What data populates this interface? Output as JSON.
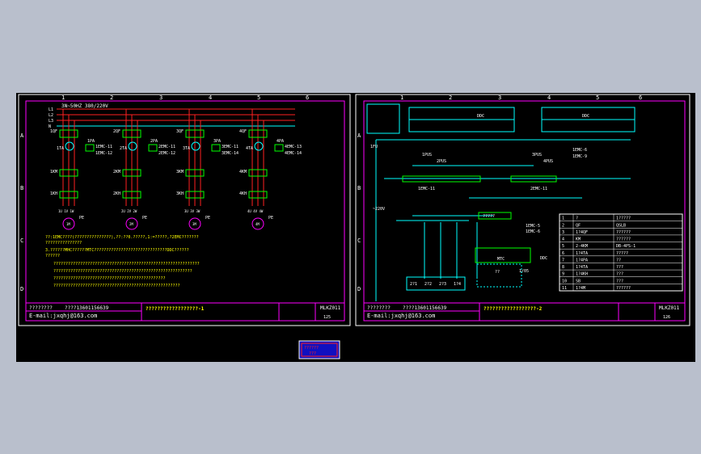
{
  "sheet1": {
    "supply": "3N~50HZ 380/220V",
    "bus_labels": [
      "L1",
      "L2",
      "L3",
      "N"
    ],
    "col_numbers": [
      "1",
      "2",
      "3",
      "4",
      "5",
      "6"
    ],
    "row_letters": [
      "A",
      "B",
      "C",
      "D"
    ],
    "pumps": [
      {
        "breaker": "1QF",
        "ct": "1TA",
        "pa": "1PA",
        "emc_a": "1EMC-11",
        "emc_b": "1EMC-12",
        "contactor": "1KM",
        "relay": "1KH",
        "terms": "1U 1V 1W",
        "motor": "1M",
        "pe": "PE"
      },
      {
        "breaker": "2QF",
        "ct": "2TA",
        "pa": "2PA",
        "emc_a": "2EMC-11",
        "emc_b": "2EMC-12",
        "contactor": "2KM",
        "relay": "2KH",
        "terms": "2U 2V 2W",
        "motor": "2M",
        "pe": "PE"
      },
      {
        "breaker": "3QF",
        "ct": "3TA",
        "pa": "3PA",
        "emc_a": "3EMC-11",
        "emc_b": "3EMC-14",
        "contactor": "3KM",
        "relay": "3KH",
        "terms": "3U 3V 3W",
        "motor": "3M",
        "pe": "PE"
      },
      {
        "breaker": "4QF",
        "ct": "4TA",
        "pa": "4PA",
        "emc_a": "4EMC-13",
        "emc_b": "4EMC-14",
        "contactor": "4KM",
        "relay": "4KH",
        "terms": "4U 4V 4W",
        "motor": "4M",
        "pe": "PE"
      }
    ],
    "notes": [
      "??:1EMC????(???????????????),??:??0.?????,1:=?????,?2EMC???????",
      "???????????????",
      "3.??????MHC??????MTC??????????????????????????????DDC??????",
      "??????",
      "????????????????????????????????????????????????????????????",
      "?????????????????????????????????????????????????????????",
      "??????????????????????????????????????????????",
      "????????????????????????????????????????????????????"
    ],
    "title_block": {
      "left": "????????",
      "phone": "????13601156639",
      "email": "E-mail:jxqhj@163.com",
      "title": "??????????????????-1",
      "drawing_no": "MLKZ011",
      "page": "125"
    }
  },
  "sheet2": {
    "col_numbers": [
      "1",
      "2",
      "3",
      "4",
      "5",
      "6"
    ],
    "row_letters": [
      "A",
      "B",
      "C",
      "D"
    ],
    "ddc_labels": [
      "DDC",
      "DDC"
    ],
    "coil_labels": [
      "1EMC-11",
      "2EMC-11",
      "1EMC-6",
      "1EMC-9"
    ],
    "pb_labels": [
      "1PUS",
      "2PUS",
      "3PUS",
      "4PUS"
    ],
    "voltage": "~220V",
    "fuse": "1FU",
    "box_label": "?????",
    "mtc_label": "MTC",
    "bottom_terms": [
      "2?1",
      "2?2",
      "2?3",
      "1?4"
    ],
    "emc_small": [
      "1EMC-5",
      "1EMC-6"
    ],
    "ddc_small": "DDC",
    "io_label": "1/05",
    "small_note": "??",
    "bom": [
      [
        "1",
        "?",
        "1?????"
      ],
      [
        "2",
        "QF",
        "QSLB"
      ],
      [
        "3",
        "1?4QF",
        "??????"
      ],
      [
        "4",
        "KM",
        "??????"
      ],
      [
        "5",
        "2-4KM",
        "DB-4PS-1"
      ],
      [
        "6",
        "1?4TA",
        "?????"
      ],
      [
        "7",
        "1?4PA",
        "??"
      ],
      [
        "8",
        "1?4TA",
        "???"
      ],
      [
        "9",
        "1?4KH",
        "???"
      ],
      [
        "10",
        "SB",
        "???"
      ],
      [
        "11",
        "1?4M",
        "??????"
      ]
    ],
    "title_block": {
      "left": "????????",
      "phone": "????13601156639",
      "email": "E-mail:jxqhj@163.com",
      "title": "??????????????????-2",
      "drawing_no": "MLKZ011",
      "page": "126"
    }
  },
  "stamp": {
    "line1": "??????",
    "line2": "???"
  }
}
